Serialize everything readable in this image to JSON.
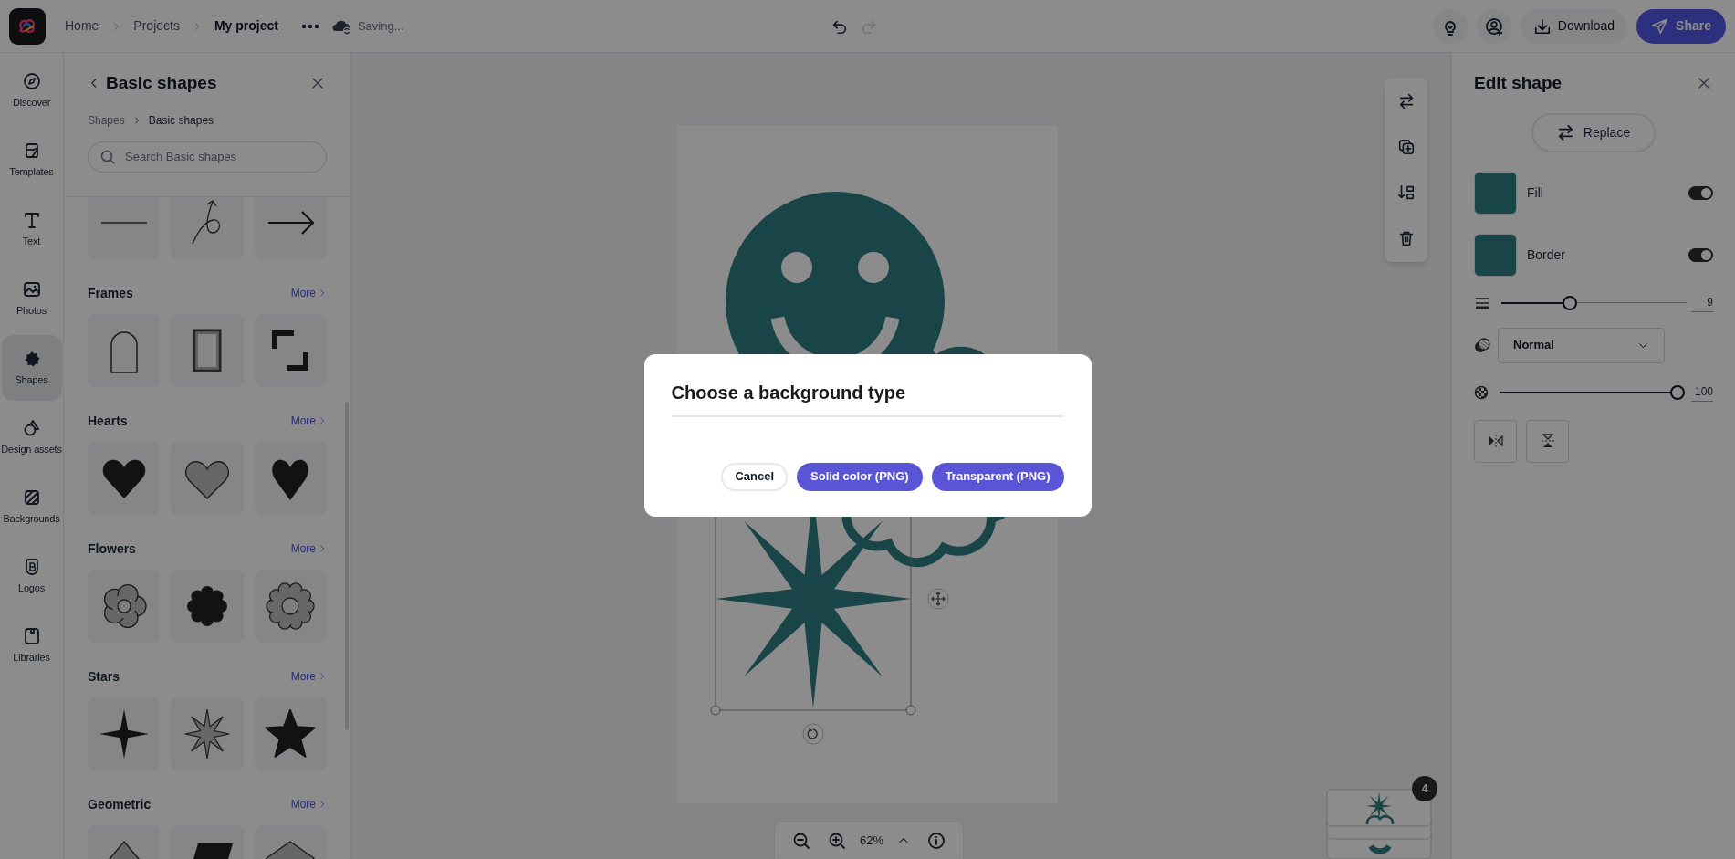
{
  "top_bar": {
    "breadcrumbs": [
      {
        "label": "Home",
        "selected": false
      },
      {
        "label": "Projects",
        "selected": false
      },
      {
        "label": "My project",
        "selected": true
      }
    ],
    "save_status": "Saving...",
    "undo": {
      "disabled": false
    },
    "redo": {
      "disabled": true
    },
    "download": "Download",
    "share": "Share"
  },
  "rail": [
    {
      "label": "Discover",
      "selected": false
    },
    {
      "label": "Templates",
      "selected": false
    },
    {
      "label": "Text",
      "selected": false
    },
    {
      "label": "Photos",
      "selected": false
    },
    {
      "label": "Shapes",
      "selected": true
    },
    {
      "label": "Design assets",
      "selected": false
    },
    {
      "label": "Backgrounds",
      "selected": false
    },
    {
      "label": "Logos",
      "selected": false
    },
    {
      "label": "Libraries",
      "selected": false
    }
  ],
  "shapes_panel": {
    "title": "Basic shapes",
    "breadcrumb": [
      "Shapes",
      "Basic shapes"
    ],
    "search": {
      "placeholder": "Search Basic shapes"
    },
    "sections": [
      {
        "title": "Frames",
        "more": "More"
      },
      {
        "title": "Hearts",
        "more": "More"
      },
      {
        "title": "Flowers",
        "more": "More"
      },
      {
        "title": "Stars",
        "more": "More"
      },
      {
        "title": "Geometric",
        "more": "More"
      }
    ]
  },
  "canvas": {
    "zoom": "62%",
    "page_count": "4"
  },
  "edit_panel": {
    "title": "Edit shape",
    "replace": "Replace",
    "properties": [
      {
        "label": "Fill",
        "on": true
      },
      {
        "label": "Border",
        "on": true
      }
    ],
    "stroke_width": {
      "level": 0.36,
      "value": "9"
    },
    "blend_mode": "Normal",
    "opacity": {
      "level": 1,
      "value": "100"
    }
  },
  "dialog": {
    "title": "Choose a background type",
    "buttons": [
      {
        "label": "Cancel",
        "kind": "secondary"
      },
      {
        "label": "Solid color (PNG)",
        "kind": "primary"
      },
      {
        "label": "Transparent (PNG)",
        "kind": "primary"
      }
    ]
  }
}
